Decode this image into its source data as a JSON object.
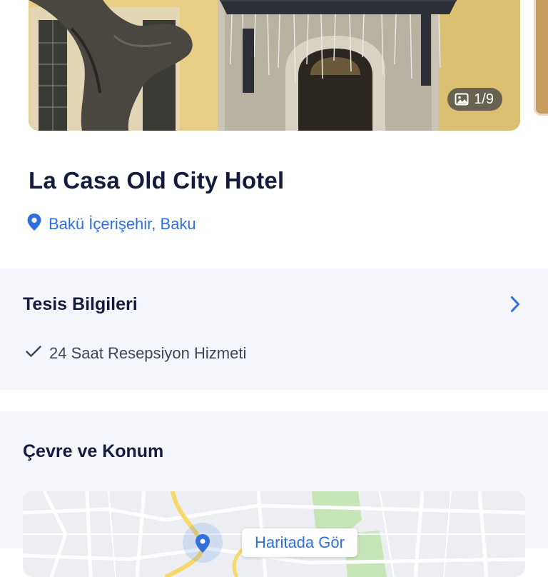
{
  "gallery": {
    "counter": "1/9",
    "icon": "image-icon"
  },
  "hotel": {
    "name": "La Casa Old City Hotel",
    "location": "Bakü İçerişehir, Baku",
    "location_icon": "map-pin-icon",
    "accent_color": "#2f6fde"
  },
  "facility": {
    "title": "Tesis Bilgileri",
    "features": [
      "24 Saat Resepsiyon Hizmeti"
    ],
    "chevron_icon": "chevron-right-icon"
  },
  "surroundings": {
    "title": "Çevre ve Konum",
    "map_button": "Haritada Gör"
  }
}
